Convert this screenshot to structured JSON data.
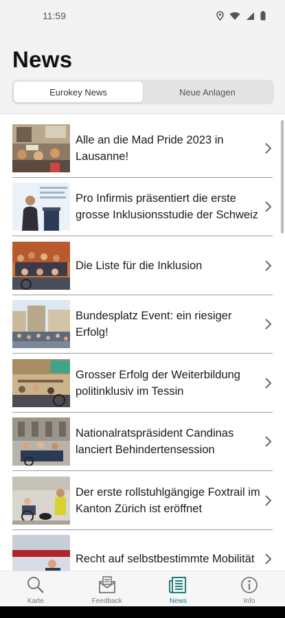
{
  "status_bar": {
    "time": "11:59",
    "icons": [
      "location-icon",
      "wifi-icon",
      "signal-icon",
      "battery-icon"
    ]
  },
  "header": {
    "title": "News",
    "segments": [
      {
        "label": "Eurokey News",
        "selected": true
      },
      {
        "label": "Neue Anlagen",
        "selected": false
      }
    ]
  },
  "news": [
    {
      "title": "Alle an die Mad Pride 2023 in Lausanne!"
    },
    {
      "title": "Pro Infirmis präsentiert die erste grosse Inklusionsstudie der Schweiz"
    },
    {
      "title": "Die Liste für die Inklusion"
    },
    {
      "title": "Bundesplatz Event: ein riesiger Erfolg!"
    },
    {
      "title": "Grosser Erfolg der Weiterbildung politinklusiv im Tessin"
    },
    {
      "title": "Nationalratspräsident Candinas lanciert Behindertensession"
    },
    {
      "title": "Der erste rollstuhlgängige Foxtrail im Kanton Zürich ist eröffnet"
    },
    {
      "title": "Recht auf selbstbestimmte Mobilität"
    }
  ],
  "tabs": [
    {
      "label": "Karte",
      "icon": "search-icon",
      "active": false
    },
    {
      "label": "Feedback",
      "icon": "feedback-icon",
      "active": false
    },
    {
      "label": "News",
      "icon": "newspaper-icon",
      "active": true
    },
    {
      "label": "Info",
      "icon": "info-icon",
      "active": false
    }
  ],
  "colors": {
    "accent": "#1f7b7b",
    "header_bg": "#f3f3f3",
    "divider": "#9a9a9a"
  }
}
